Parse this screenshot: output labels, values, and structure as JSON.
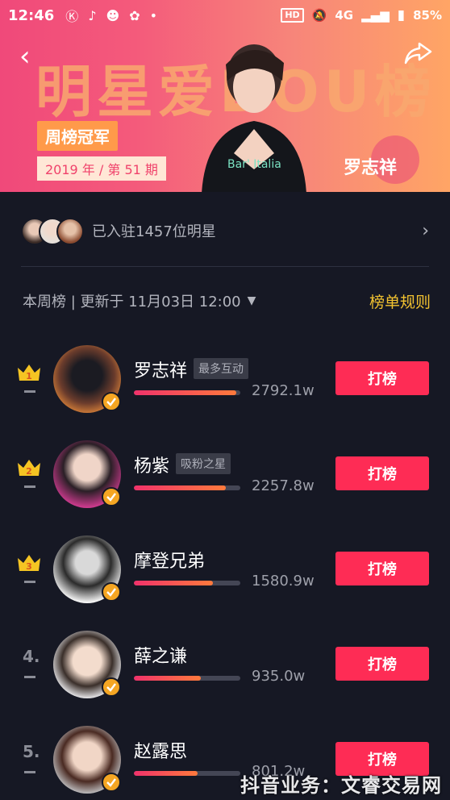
{
  "status_bar": {
    "time": "12:46",
    "hd": "HD",
    "network": "4G",
    "battery": "85%"
  },
  "banner": {
    "big_title": "明星爱DOU榜",
    "champion_label": "周榜冠军",
    "period": "2019 年 / 第 51 期",
    "star_name": "罗志祥"
  },
  "joined": {
    "label": "已入驻1457位明星"
  },
  "week": {
    "label": "本周榜 | 更新于 11月03日 12:00",
    "rules_label": "榜单规则"
  },
  "colors": {
    "accent": "#fe2c55",
    "gold": "#f2c230",
    "verify": "#f5a623"
  },
  "ranking": [
    {
      "rank": "1",
      "crown": true,
      "name": "罗志祥",
      "tag": "最多互动",
      "score": "2792.1w",
      "progress": 0.96,
      "button": "打榜"
    },
    {
      "rank": "2",
      "crown": true,
      "name": "杨紫",
      "tag": "吸粉之星",
      "score": "2257.8w",
      "progress": 0.86,
      "button": "打榜"
    },
    {
      "rank": "3",
      "crown": true,
      "name": "摩登兄弟",
      "tag": "",
      "score": "1580.9w",
      "progress": 0.74,
      "button": "打榜"
    },
    {
      "rank": "4.",
      "crown": false,
      "name": "薛之谦",
      "tag": "",
      "score": "935.0w",
      "progress": 0.63,
      "button": "打榜"
    },
    {
      "rank": "5.",
      "crown": false,
      "name": "赵露思",
      "tag": "",
      "score": "801.2w",
      "progress": 0.6,
      "button": "打榜"
    }
  ],
  "watermark": "抖音业务：文睿交易网"
}
